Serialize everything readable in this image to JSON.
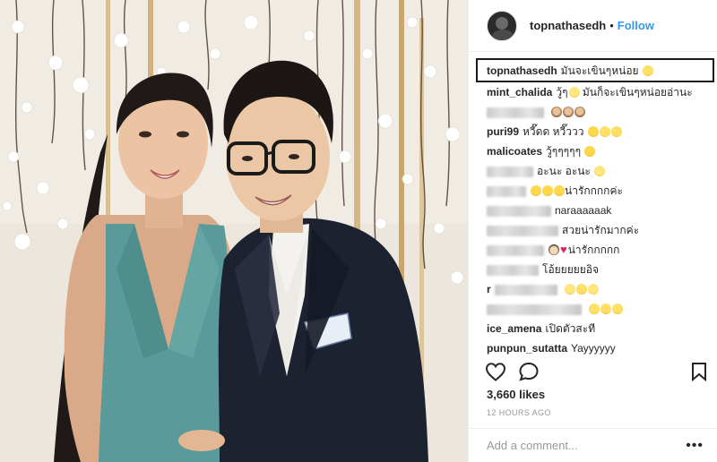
{
  "header": {
    "username": "topnathasedh",
    "separator": "•",
    "follow_label": "Follow"
  },
  "caption": {
    "user": "topnathasedh",
    "text": "มันจะเขินๆหน่อย"
  },
  "comments": [
    {
      "user": "mint_chalida",
      "text": "วู้ๆ",
      "text2": "มันก็จะเขินๆหน่อยอ่านะ"
    },
    {
      "user": "",
      "text": ""
    },
    {
      "user": "puri99",
      "text": "หวี๊ดด หวี๊ววว"
    },
    {
      "user": "malicoates",
      "text": "วู้ๆๆๆๆๆ"
    },
    {
      "user": "",
      "text": "อะนะ อะนะ"
    },
    {
      "user": "",
      "text": "น่ารักกกกค่ะ"
    },
    {
      "user": "",
      "text": "naraaaaaak"
    },
    {
      "user": "",
      "text": "สวยน่ารักมากค่ะ"
    },
    {
      "user": "",
      "text": "น่ารักกกกก"
    },
    {
      "user": "",
      "text": "โอ้ยยยยยอิจ"
    },
    {
      "user": "r",
      "text": ""
    },
    {
      "user": "",
      "text": ""
    },
    {
      "user": "ice_amena",
      "text": "เปิดตัวสะที"
    },
    {
      "user": "punpun_sutatta",
      "text": "Yayyyyyy"
    }
  ],
  "actions": {
    "like_icon": "heart-outline-icon",
    "comment_icon": "speech-bubble-icon",
    "save_icon": "bookmark-icon"
  },
  "likes": "3,660 likes",
  "timestamp": "12 HOURS AGO",
  "add_comment": {
    "placeholder": "Add a comment...",
    "more_label": "•••"
  },
  "colors": {
    "link": "#3897f0",
    "text": "#262626",
    "muted": "#999999",
    "border": "#efefef"
  }
}
